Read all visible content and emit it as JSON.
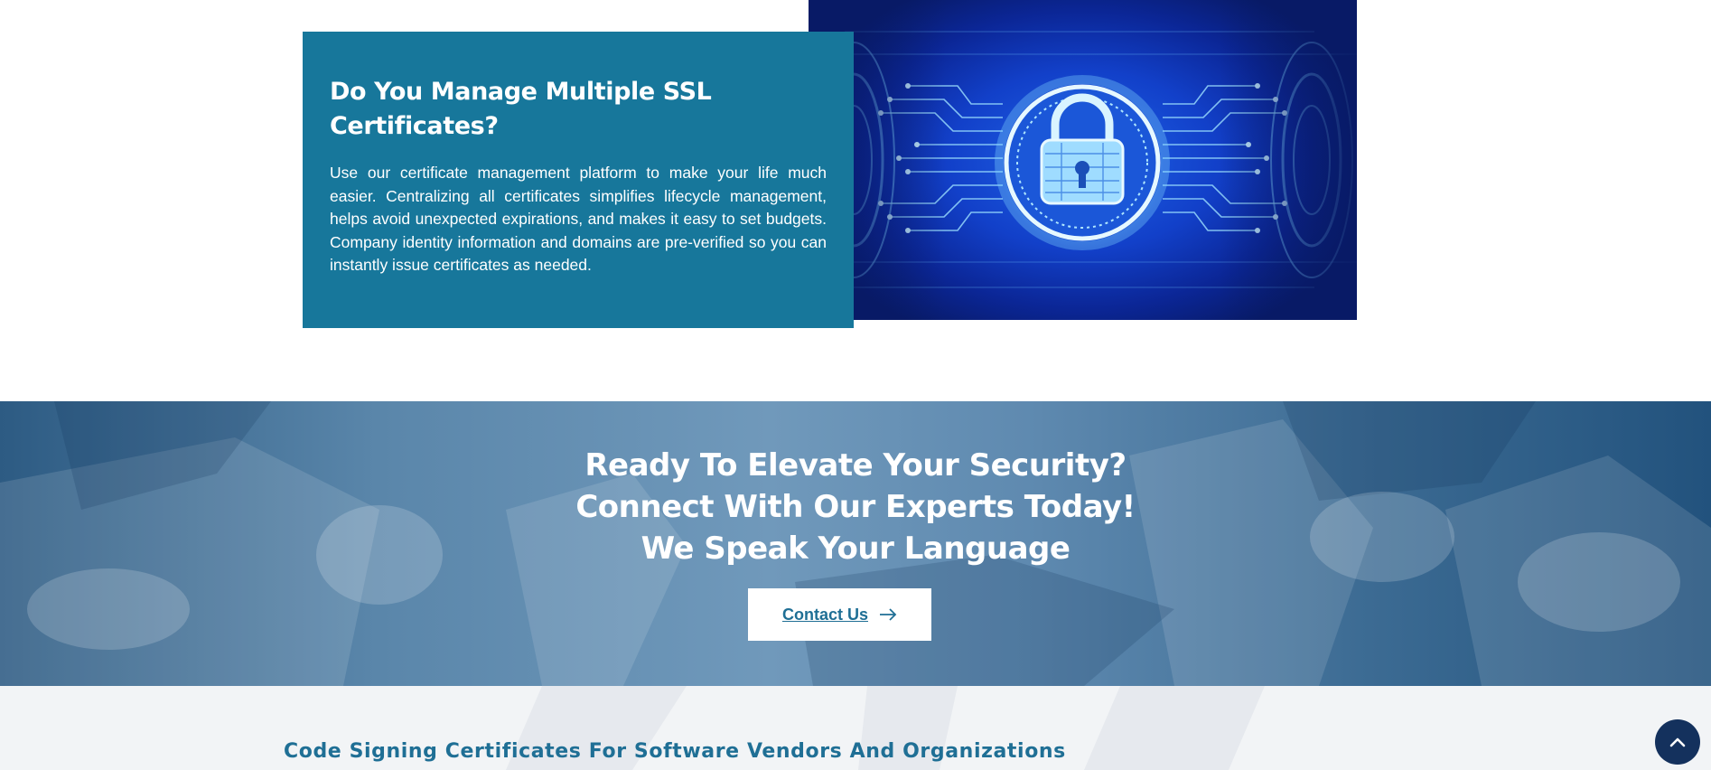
{
  "feature": {
    "title": "Do You Manage Multiple SSL Certificates?",
    "description": "Use our certificate management platform to make your life much easier. Centralizing all certificates simplifies lifecycle management, helps avoid unexpected expirations, and makes it easy to set budgets. Company identity information and domains are pre-verified so you can instantly issue certificates as needed.",
    "image_icon": "padlock-circuit-icon"
  },
  "cta": {
    "line1": "Ready To Elevate Your Security?",
    "line2": "Connect With Our Experts Today!",
    "line3": "We Speak Your Language",
    "button_label": "Contact Us",
    "button_icon": "arrow-right-icon"
  },
  "bottom": {
    "heading": "Code Signing Certificates For Software Vendors And Organizations"
  },
  "scroll_top": {
    "icon": "chevron-up-icon"
  },
  "colors": {
    "card_background": "#17779b",
    "accent_text": "#1f6f95",
    "scroll_button": "#14315d",
    "bottom_background": "#f2f4f6"
  }
}
